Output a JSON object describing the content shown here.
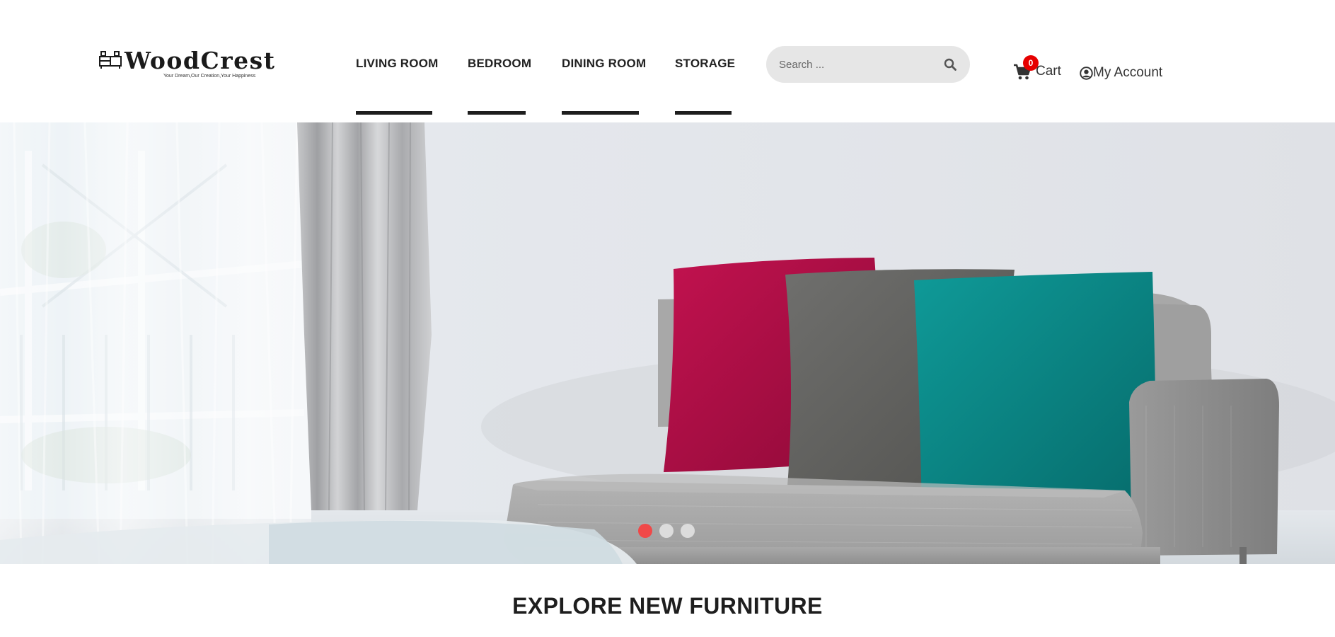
{
  "brand": {
    "name": "WoodCrest",
    "tagline": "Your Dream,Our Creation,Your Happiness"
  },
  "nav": {
    "items": [
      {
        "label": "LIVING ROOM"
      },
      {
        "label": "BEDROOM"
      },
      {
        "label": "DINING ROOM"
      },
      {
        "label": "STORAGE"
      }
    ]
  },
  "search": {
    "placeholder": "Search ...",
    "value": "",
    "icon": "search-icon"
  },
  "cart": {
    "label": "Cart",
    "count": "0",
    "icon": "cart-icon",
    "badge_color": "#e60000"
  },
  "account": {
    "label": "My Account",
    "icon": "user-circle-icon"
  },
  "hero": {
    "slides": 3,
    "active_slide": 1,
    "active_dot_color": "#f04848"
  },
  "section": {
    "title": "EXPLORE NEW FURNITURE"
  }
}
